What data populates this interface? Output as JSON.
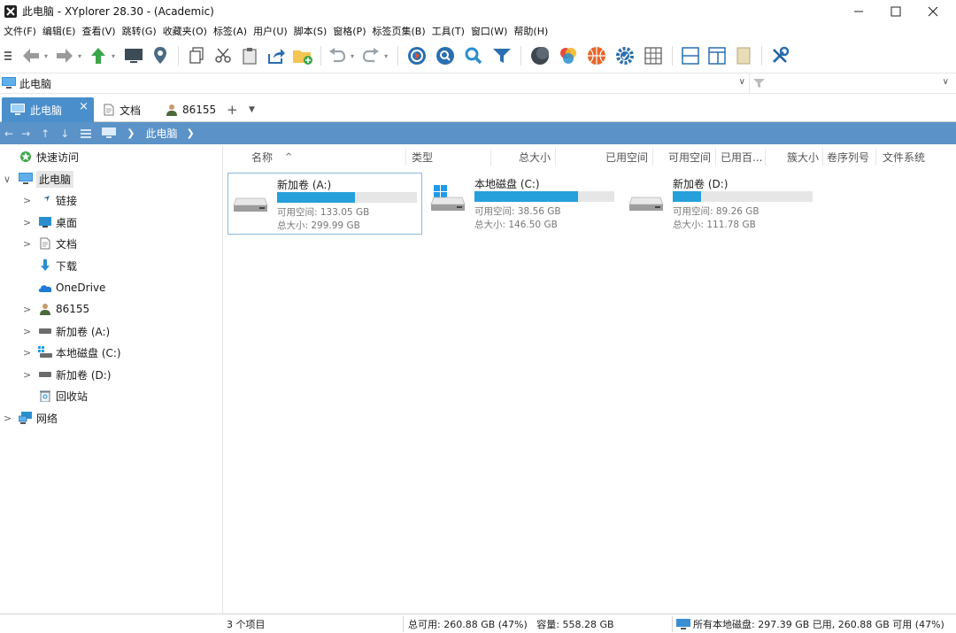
{
  "window": {
    "title": "此电脑 - XYplorer 28.30 - (Academic)"
  },
  "menu": [
    "文件(F)",
    "编辑(E)",
    "查看(V)",
    "跳转(G)",
    "收藏夹(O)",
    "标签(A)",
    "用户(U)",
    "脚本(S)",
    "窗格(P)",
    "标签页集(B)",
    "工具(T)",
    "窗口(W)",
    "帮助(H)"
  ],
  "toolbar": {
    "icons": [
      "menu-icon",
      "back-arrow-icon",
      "forward-arrow-icon",
      "up-arrow-icon",
      "computer-icon",
      "location-pin-icon",
      "copy-icon",
      "cut-icon",
      "paste-icon",
      "share-icon",
      "new-folder-icon",
      "undo-icon",
      "redo-icon",
      "refresh-icon",
      "search-icon",
      "quick-search-icon",
      "filter-icon",
      "dark-mode-icon",
      "color-icon",
      "ball-icon",
      "settings-gear-icon",
      "grid-icon",
      "horizontal-pane-icon",
      "preview-pane-icon",
      "info-panel-icon",
      "tools-icon"
    ]
  },
  "address": {
    "value": "此电脑"
  },
  "tabs": [
    {
      "label": "此电脑",
      "icon": "computer-icon",
      "active": true
    },
    {
      "label": "文档",
      "icon": "document-icon",
      "active": false
    },
    {
      "label": "86155",
      "icon": "user-icon",
      "active": false
    }
  ],
  "breadcrumb": {
    "current": "此电脑"
  },
  "tree": [
    {
      "label": "快速访问",
      "icon": "quick-access-icon",
      "expander": "",
      "level": 0
    },
    {
      "label": "此电脑",
      "icon": "computer-icon",
      "expander": "∨",
      "level": 0,
      "selected": true
    },
    {
      "label": "链接",
      "icon": "link-icon",
      "expander": ">",
      "level": 1
    },
    {
      "label": "桌面",
      "icon": "desktop-icon",
      "expander": ">",
      "level": 1
    },
    {
      "label": "文档",
      "icon": "document-icon",
      "expander": ">",
      "level": 1
    },
    {
      "label": "下载",
      "icon": "download-icon",
      "expander": "",
      "level": 1
    },
    {
      "label": "OneDrive",
      "icon": "cloud-icon",
      "expander": "",
      "level": 1
    },
    {
      "label": "86155",
      "icon": "user-icon",
      "expander": ">",
      "level": 1
    },
    {
      "label": "新加卷 (A:)",
      "icon": "drive-icon",
      "expander": ">",
      "level": 1
    },
    {
      "label": "本地磁盘 (C:)",
      "icon": "system-drive-icon",
      "expander": ">",
      "level": 1
    },
    {
      "label": "新加卷 (D:)",
      "icon": "drive-icon",
      "expander": ">",
      "level": 1
    },
    {
      "label": "回收站",
      "icon": "recycle-bin-icon",
      "expander": "",
      "level": 1
    },
    {
      "label": "网络",
      "icon": "network-icon",
      "expander": ">",
      "level": 0
    }
  ],
  "columns": [
    "名称",
    "类型",
    "总大小",
    "已用空间",
    "可用空间",
    "已用百...",
    "簇大小",
    "卷序列号",
    "文件系统"
  ],
  "drives": [
    {
      "name": "新加卷 (A:)",
      "free": "可用空间: 133.05 GB",
      "total": "总大小: 299.99 GB",
      "used_fraction": 0.56,
      "system": false
    },
    {
      "name": "本地磁盘 (C:)",
      "free": "可用空间: 38.56 GB",
      "total": "总大小: 146.50 GB",
      "used_fraction": 0.74,
      "system": true
    },
    {
      "name": "新加卷 (D:)",
      "free": "可用空间: 89.26 GB",
      "total": "总大小: 111.78 GB",
      "used_fraction": 0.2,
      "system": false
    }
  ],
  "status": {
    "count": "3 个项目",
    "summary": "总可用: 260.88 GB (47%)   容量: 558.28 GB",
    "all_drives": "所有本地磁盘: 297.39 GB 已用, 260.88 GB 可用 (47%)"
  },
  "colors": {
    "accent": "#4a8fcb",
    "navbar": "#5b93c8",
    "bar_fill": "#26a0da"
  }
}
